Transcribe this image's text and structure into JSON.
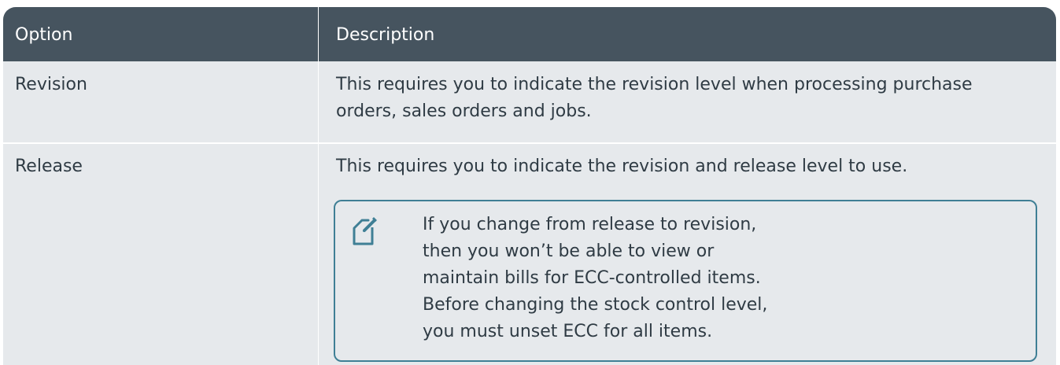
{
  "table": {
    "headers": [
      "Option",
      "Description"
    ],
    "rows": [
      {
        "option": "Revision",
        "description": "This requires you to indicate the revision level when processing purchase orders, sales orders and jobs."
      },
      {
        "option": "Release",
        "description": "This requires you to indicate the revision and release level to use.",
        "note": "If you change from release to revision, then you won’t be able to view or maintain bills for ECC-controlled items. Before changing the stock control level, you must unset ECC for all items."
      }
    ]
  },
  "icons": {
    "note": "note-edit-icon"
  },
  "colors": {
    "header_bg": "#46545f",
    "body_bg": "#e6e9ec",
    "note_border": "#3f7f95",
    "text": "#2f3b44"
  }
}
